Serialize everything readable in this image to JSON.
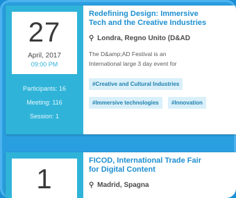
{
  "events": [
    {
      "day": "27",
      "month": "April, 2017",
      "time": "09:00 PM",
      "stats": [
        "Participants: 16",
        "Meeting: 116",
        "Session: 1"
      ],
      "title_line1": "Redefining Design: Immersive",
      "title_line2": "Tech and the Creative Industries",
      "location": "Londra, Regno Unito (D&AD",
      "desc_line1": "The D&amp;AD Festival is an",
      "desc_line2": "International large 3 day event for",
      "tags_row1": [
        "#Creative and Cultural Industries"
      ],
      "tags_row2": [
        "#Immersive technologies",
        "#Innovation"
      ]
    },
    {
      "day": "1",
      "title_line1": "FICOD, International Trade Fair",
      "title_line2": "for Digital Content",
      "location": "Madrid, Spagna"
    }
  ],
  "icons": {
    "location": "map-pin-icon"
  },
  "colors": {
    "accent": "#2fb3d9",
    "title": "#1e8fd0",
    "background": "#2a9fe0"
  }
}
